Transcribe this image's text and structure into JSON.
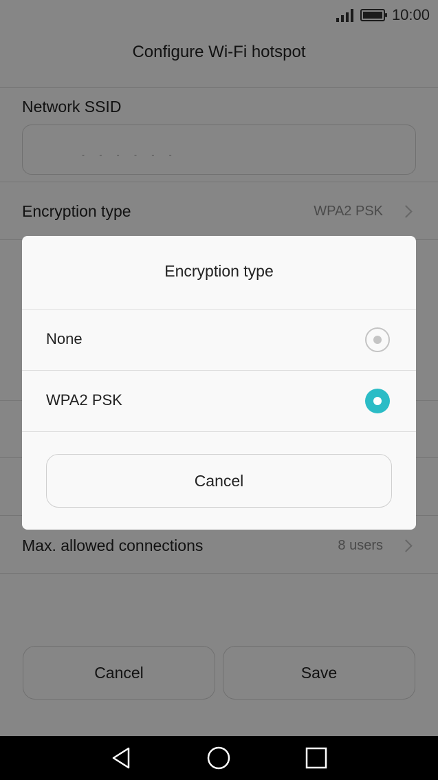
{
  "status_bar": {
    "time": "10:00",
    "icons": [
      "signal-icon",
      "battery-icon"
    ]
  },
  "page": {
    "title": "Configure Wi-Fi hotspot"
  },
  "network_ssid": {
    "label": "Network SSID",
    "value": "- - - - - -"
  },
  "encryption_row": {
    "label": "Encryption type",
    "value": "WPA2 PSK"
  },
  "max_connections_row": {
    "label": "Max. allowed connections",
    "value": "8 users"
  },
  "footer_buttons": {
    "cancel_label": "Cancel",
    "save_label": "Save"
  },
  "dialog": {
    "title": "Encryption type",
    "options": [
      {
        "label": "None",
        "selected": false
      },
      {
        "label": "WPA2 PSK",
        "selected": true
      }
    ],
    "cancel_label": "Cancel"
  },
  "colors": {
    "accent": "#2bbcc6",
    "overlay": "rgba(0,0,0,0.46)",
    "nav_bar": "#000000"
  },
  "nav_bar": {
    "icons": [
      "back-icon",
      "home-icon",
      "recents-icon"
    ]
  }
}
